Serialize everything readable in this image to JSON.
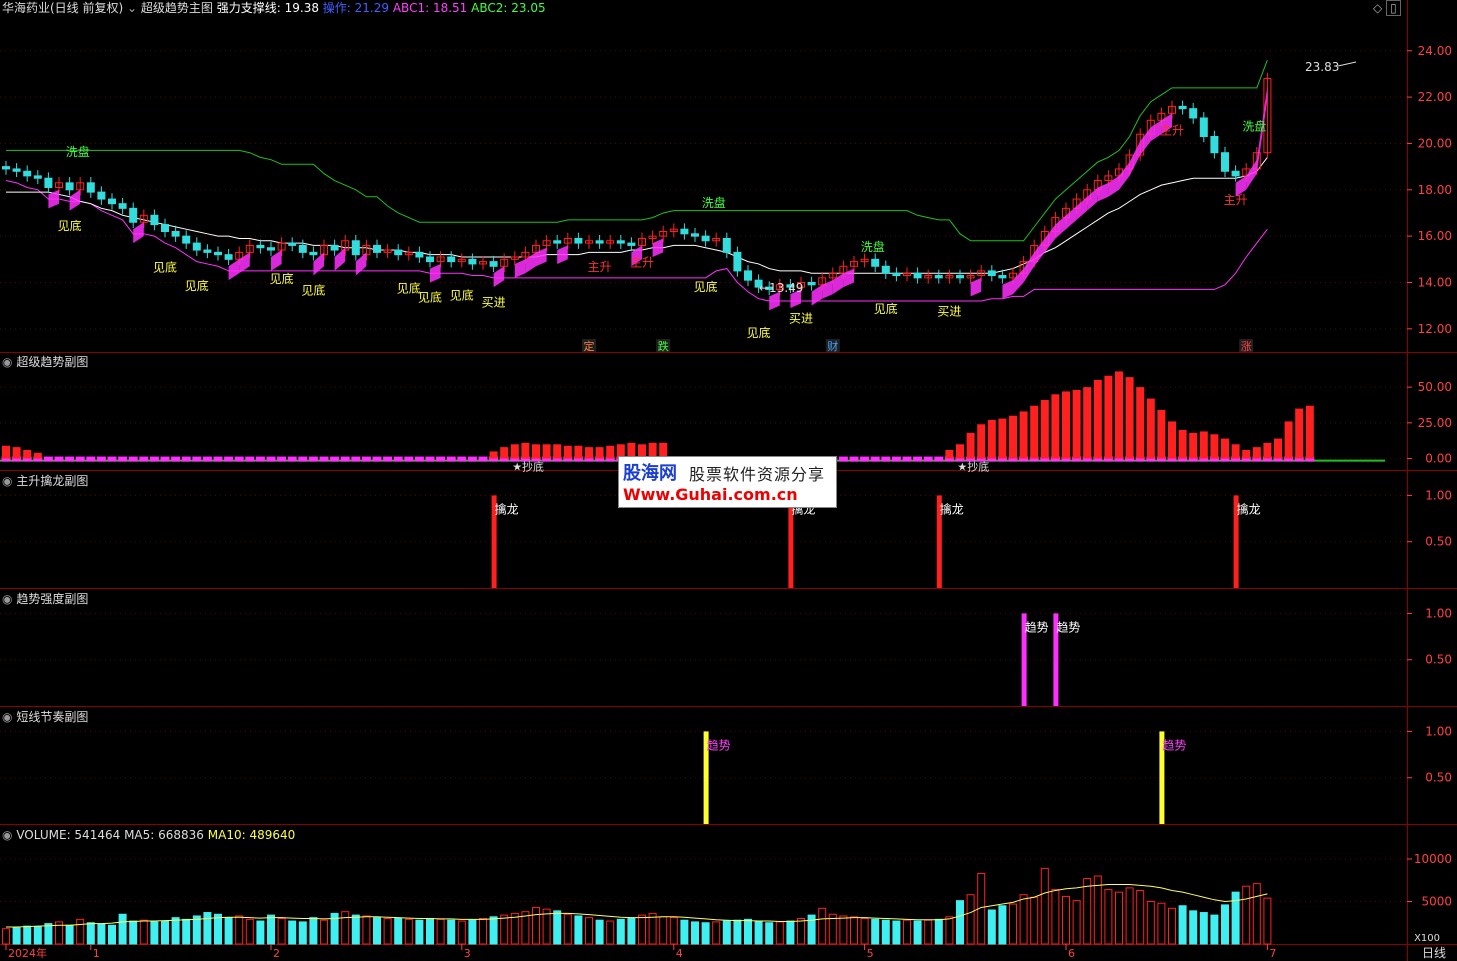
{
  "header": {
    "stock_title": "华海药业(日线 前复权)",
    "indicator_name": "超级趋势主图",
    "support_label": "强力支撑线: 19.38",
    "op_label": "操作: 21.29",
    "abc1_label": "ABC1: 18.51",
    "abc2_label": "ABC2: 23.05"
  },
  "colors": {
    "background": "#000000",
    "panel_border": "#8a0000",
    "axis_text": "#ff4040",
    "up": "#ff2020",
    "down": "#33dddd",
    "magenta": "#ff30ff",
    "green_line": "#20c020",
    "yellow": "#ffff40"
  },
  "chart_data": [
    {
      "panel": "main",
      "type": "candlestick",
      "title": "超级趋势主图",
      "ylim": [
        11,
        25.5
      ],
      "yticks": [
        "24.00",
        "22.00",
        "20.00",
        "18.00",
        "16.00",
        "14.00",
        "12.00"
      ],
      "high_annotation": "23.83",
      "low_annotation": "13.49",
      "x_count": 120,
      "close": [
        18.9,
        18.8,
        18.6,
        18.5,
        18.1,
        18.3,
        18.0,
        18.3,
        17.9,
        17.6,
        17.4,
        17.2,
        16.6,
        16.9,
        16.5,
        16.2,
        16.0,
        15.7,
        15.4,
        15.3,
        15.2,
        15.0,
        15.3,
        15.6,
        15.5,
        15.4,
        15.7,
        15.6,
        15.3,
        15.2,
        15.6,
        15.4,
        15.8,
        15.2,
        15.6,
        15.3,
        15.4,
        15.2,
        15.3,
        15.1,
        14.9,
        15.1,
        14.9,
        15.0,
        14.8,
        14.9,
        14.7,
        15.0,
        15.1,
        15.3,
        15.6,
        15.8,
        15.7,
        15.9,
        15.7,
        15.8,
        15.7,
        15.8,
        15.7,
        15.6,
        15.9,
        16.0,
        16.2,
        16.3,
        16.1,
        16.0,
        15.8,
        15.9,
        15.3,
        14.5,
        14.1,
        13.8,
        13.7,
        13.9,
        13.8,
        14.0,
        13.9,
        14.2,
        14.4,
        14.7,
        14.9,
        15.0,
        14.7,
        14.4,
        14.3,
        14.4,
        14.2,
        14.3,
        14.2,
        14.3,
        14.2,
        14.3,
        14.5,
        14.3,
        14.2,
        14.4,
        14.9,
        15.6,
        16.2,
        16.8,
        17.2,
        17.6,
        18.0,
        18.4,
        18.6,
        18.9,
        19.5,
        20.4,
        21.0,
        21.3,
        21.6,
        21.5,
        21.1,
        20.3,
        19.6,
        18.8,
        18.6,
        18.9,
        19.6,
        22.8
      ],
      "support_line": [
        17.9,
        17.9,
        17.9,
        17.9,
        17.9,
        17.8,
        17.7,
        17.5,
        17.4,
        17.2,
        17.1,
        16.9,
        16.8,
        16.7,
        16.6,
        16.5,
        16.4,
        16.3,
        16.2,
        16.1,
        16.0,
        16.0,
        15.9,
        15.9,
        15.8,
        15.8,
        15.7,
        15.7,
        15.7,
        15.6,
        15.6,
        15.6,
        15.5,
        15.5,
        15.5,
        15.4,
        15.4,
        15.4,
        15.3,
        15.3,
        15.2,
        15.2,
        15.2,
        15.1,
        15.1,
        15.1,
        15.1,
        15.1,
        15.1,
        15.1,
        15.1,
        15.2,
        15.2,
        15.2,
        15.2,
        15.3,
        15.3,
        15.3,
        15.3,
        15.4,
        15.4,
        15.5,
        15.5,
        15.6,
        15.6,
        15.6,
        15.5,
        15.4,
        15.3,
        15.1,
        14.9,
        14.8,
        14.6,
        14.5,
        14.5,
        14.5,
        14.4,
        14.4,
        14.4,
        14.4,
        14.4,
        14.4,
        14.4,
        14.4,
        14.4,
        14.4,
        14.4,
        14.4,
        14.4,
        14.4,
        14.4,
        14.4,
        14.4,
        14.4,
        14.5,
        14.6,
        14.8,
        15.0,
        15.3,
        15.5,
        15.8,
        16.1,
        16.4,
        16.7,
        17.0,
        17.2,
        17.5,
        17.8,
        18.0,
        18.2,
        18.3,
        18.4,
        18.5,
        18.5,
        18.5,
        18.5,
        18.5,
        18.6,
        18.8,
        19.4
      ],
      "labels": [
        {
          "i": 6,
          "text": "见底",
          "below": true,
          "offset": 40
        },
        {
          "i": 15,
          "text": "见底",
          "below": true,
          "offset": 40
        },
        {
          "i": 18,
          "text": "见底",
          "below": true,
          "offset": 40
        },
        {
          "i": 26,
          "text": "见底",
          "below": true,
          "offset": 40
        },
        {
          "i": 29,
          "text": "见底",
          "below": true,
          "offset": 40
        },
        {
          "i": 38,
          "text": "见底",
          "below": true,
          "offset": 40
        },
        {
          "i": 40,
          "text": "见底",
          "below": true,
          "offset": 40
        },
        {
          "i": 43,
          "text": "见底",
          "below": true,
          "offset": 40
        },
        {
          "i": 46,
          "text": "买进",
          "below": true,
          "offset": 40
        },
        {
          "i": 66,
          "text": "见底",
          "below": true,
          "offset": 50
        },
        {
          "i": 71,
          "text": "见底",
          "below": true,
          "offset": 50
        },
        {
          "i": 75,
          "text": "买进",
          "below": true,
          "offset": 40
        },
        {
          "i": 83,
          "text": "见底",
          "below": true,
          "offset": 40
        },
        {
          "i": 89,
          "text": "买进",
          "below": true,
          "offset": 40
        }
      ],
      "red_labels": [
        {
          "i": 56,
          "text": "主升"
        },
        {
          "i": 60,
          "text": "主升"
        },
        {
          "i": 110,
          "text": "主升"
        },
        {
          "i": 116,
          "text": "主升"
        }
      ],
      "xipan_labels": [
        {
          "i": 3,
          "text": "洗盘"
        },
        {
          "i": 63,
          "text": "洗盘"
        },
        {
          "i": 78,
          "text": "洗盘"
        },
        {
          "i": 114,
          "text": "洗盘"
        }
      ],
      "event_markers": [
        {
          "i": 55,
          "text": "定",
          "color": "#ff8040"
        },
        {
          "i": 62,
          "text": "跌",
          "color": "#40ff40"
        },
        {
          "i": 78,
          "text": "财",
          "color": "#40a0ff"
        },
        {
          "i": 117,
          "text": "涨",
          "color": "#ff4040"
        }
      ]
    },
    {
      "panel": "sub1",
      "type": "bar",
      "title": "超级趋势副图",
      "ylim": [
        -8,
        62
      ],
      "yticks": [
        "50.00",
        "25.00",
        "0.00"
      ],
      "values": [
        9,
        8,
        6,
        4,
        0,
        0,
        0,
        0,
        0,
        0,
        0,
        0,
        0,
        0,
        0,
        0,
        0,
        0,
        0,
        0,
        0,
        0,
        0,
        0,
        0,
        0,
        0,
        0,
        0,
        0,
        0,
        0,
        0,
        0,
        0,
        0,
        0,
        0,
        0,
        0,
        0,
        0,
        0,
        0,
        0,
        0,
        5,
        8,
        10,
        11,
        10,
        10,
        10,
        9,
        9,
        8,
        8,
        9,
        10,
        11,
        10,
        11,
        11,
        0,
        0,
        0,
        0,
        0,
        0,
        0,
        0,
        0,
        0,
        0,
        0,
        0,
        0,
        0,
        0,
        0,
        0,
        0,
        0,
        0,
        0,
        0,
        0,
        0,
        0,
        6,
        10,
        18,
        24,
        27,
        28,
        30,
        33,
        37,
        41,
        45,
        47,
        48,
        50,
        55,
        58,
        61,
        57,
        50,
        42,
        34,
        26,
        20,
        18,
        19,
        17,
        14,
        10,
        6,
        8,
        11,
        14,
        26,
        35,
        37
      ],
      "labels": [
        {
          "i": 47,
          "text": "抄底"
        },
        {
          "i": 89,
          "text": "抄底"
        }
      ]
    },
    {
      "panel": "sub2",
      "type": "bar",
      "title": "主升擒龙副图",
      "ylim": [
        0,
        1.08
      ],
      "yticks": [
        "1.00",
        "0.50"
      ],
      "spikes": [
        {
          "i": 46,
          "text": "擒龙"
        },
        {
          "i": 74,
          "text": "擒龙"
        },
        {
          "i": 88,
          "text": "擒龙"
        },
        {
          "i": 116,
          "text": "擒龙"
        }
      ]
    },
    {
      "panel": "sub3",
      "type": "bar",
      "title": "趋势强度副图",
      "ylim": [
        0,
        1.08
      ],
      "yticks": [
        "1.00",
        "0.50"
      ],
      "spikes": [
        {
          "i": 96,
          "text": "趋势"
        },
        {
          "i": 99,
          "text": "趋势"
        }
      ]
    },
    {
      "panel": "sub4",
      "type": "bar",
      "title": "短线节奏副图",
      "ylim": [
        0,
        1.08
      ],
      "yticks": [
        "1.00",
        "0.50"
      ],
      "spikes": [
        {
          "i": 66,
          "text": "趋势"
        },
        {
          "i": 109,
          "text": "趋势"
        }
      ]
    },
    {
      "panel": "volume",
      "type": "bar",
      "title": "VOLUME: 541464",
      "ma5_label": "MA5: 668836",
      "ma10_label": "MA10: 489640",
      "ylim": [
        0,
        12000
      ],
      "yticks": [
        "10000",
        "5000"
      ],
      "unit_label": "X100",
      "values": [
        1800,
        1900,
        2100,
        2000,
        2400,
        2600,
        2200,
        2900,
        2500,
        2300,
        2200,
        3500,
        2700,
        2800,
        2600,
        2700,
        3100,
        2900,
        3300,
        3700,
        3500,
        3100,
        3300,
        2900,
        2700,
        3400,
        3000,
        2700,
        2600,
        3100,
        2800,
        3600,
        3800,
        3400,
        3300,
        3100,
        3000,
        3000,
        2900,
        2800,
        3000,
        2900,
        2800,
        2700,
        2800,
        3000,
        3200,
        3400,
        3600,
        3800,
        4300,
        4100,
        3900,
        3500,
        3300,
        3100,
        2800,
        2700,
        2900,
        3000,
        3400,
        3600,
        3200,
        3100,
        2800,
        2600,
        2500,
        2600,
        2700,
        2800,
        2900,
        2700,
        2500,
        2600,
        2700,
        3000,
        3400,
        4200,
        3500,
        3300,
        3200,
        3000,
        2900,
        2800,
        2700,
        2800,
        2700,
        2800,
        2900,
        3200,
        5100,
        5800,
        8300,
        4000,
        4500,
        4700,
        5800,
        5500,
        8900,
        6400,
        5600,
        5100,
        7700,
        8000,
        6400,
        6100,
        6600,
        6300,
        5000,
        4800,
        4200,
        4500,
        3900,
        3700,
        3400,
        4600,
        6100,
        6800,
        7100,
        5400
      ],
      "ma_line": [
        2000,
        2000,
        2050,
        2100,
        2150,
        2200,
        2200,
        2300,
        2400,
        2400,
        2450,
        2600,
        2650,
        2700,
        2700,
        2750,
        2800,
        2850,
        2900,
        3000,
        3100,
        3150,
        3150,
        3100,
        3050,
        3100,
        3100,
        3050,
        3000,
        3000,
        2950,
        3000,
        3100,
        3150,
        3200,
        3200,
        3150,
        3100,
        3050,
        3000,
        3000,
        2950,
        2950,
        2900,
        2900,
        2900,
        2950,
        3050,
        3150,
        3300,
        3450,
        3550,
        3600,
        3600,
        3550,
        3450,
        3350,
        3250,
        3150,
        3100,
        3100,
        3150,
        3200,
        3200,
        3150,
        3050,
        2950,
        2850,
        2800,
        2750,
        2750,
        2700,
        2700,
        2650,
        2650,
        2700,
        2800,
        2950,
        3000,
        3050,
        3100,
        3100,
        3050,
        3000,
        2950,
        2900,
        2850,
        2850,
        2850,
        2950,
        3300,
        3700,
        4300,
        4500,
        4700,
        4900,
        5300,
        5500,
        6000,
        6300,
        6500,
        6600,
        6800,
        6900,
        7000,
        7000,
        7000,
        6900,
        6800,
        6600,
        6300,
        6100,
        5800,
        5500,
        5200,
        5000,
        5100,
        5300,
        5600,
        5900
      ]
    }
  ],
  "x_axis": {
    "labels": [
      {
        "i": 0,
        "text": "2024年"
      },
      {
        "i": 8,
        "text": "1"
      },
      {
        "i": 25,
        "text": "2"
      },
      {
        "i": 43,
        "text": "3"
      },
      {
        "i": 63,
        "text": "4"
      },
      {
        "i": 81,
        "text": "5"
      },
      {
        "i": 100,
        "text": "6"
      },
      {
        "i": 119,
        "text": "7"
      }
    ],
    "period_label": "日线"
  },
  "watermark": {
    "line1a": "股海网",
    "line1b": "股票软件资源分享",
    "line2": "Www.Guhai.com.cn"
  }
}
